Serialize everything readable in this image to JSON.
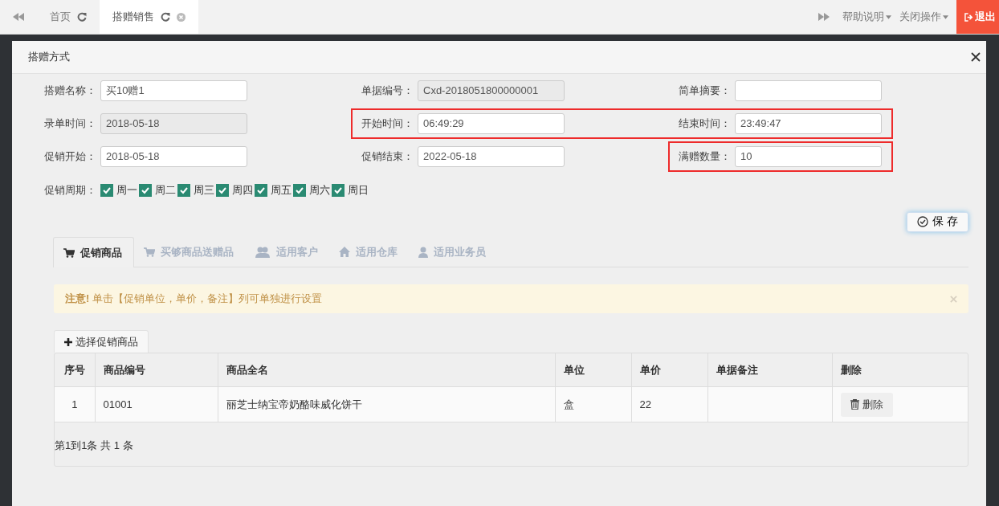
{
  "top_bar": {
    "tabs": [
      {
        "label": "首页",
        "selected": false
      },
      {
        "label": "搭赠销售",
        "selected": true
      }
    ],
    "menus": [
      "帮助说明",
      "关闭操作"
    ],
    "logout_button": "退出"
  },
  "dialog": {
    "title": "搭赠方式",
    "form_rows": [
      [
        {
          "label": "搭赠名称：",
          "value": "买10赠1",
          "disabled": false,
          "highlighted": false
        },
        {
          "label": "单据编号：",
          "value": "Cxd-2018051800000001",
          "disabled": true,
          "highlighted": false
        },
        {
          "label": "简单摘要：",
          "disabled": false,
          "highlighted": false
        }
      ],
      [
        {
          "label": "录单时间：",
          "value": "2018-05-18",
          "disabled": true,
          "highlighted": false
        },
        {
          "label": "开始时间：",
          "value": "06:49:29",
          "disabled": false,
          "highlighted": true
        },
        {
          "label": "结束时间：",
          "value": "23:49:47",
          "disabled": false,
          "highlighted": true
        }
      ],
      [
        {
          "label": "促销开始：",
          "value": "2018-05-18",
          "disabled": false,
          "highlighted": false
        },
        {
          "label": "促销结束：",
          "value": "2022-05-18",
          "disabled": false,
          "highlighted": false
        },
        {
          "label": "满赠数量：",
          "value": "10",
          "disabled": false,
          "highlighted": true
        }
      ]
    ],
    "week": {
      "label": "促销周期：",
      "days": [
        {
          "label": "周一",
          "checked": true
        },
        {
          "label": "周二",
          "checked": true
        },
        {
          "label": "周三",
          "checked": true
        },
        {
          "label": "周四",
          "checked": true
        },
        {
          "label": "周五",
          "checked": true
        },
        {
          "label": "周六",
          "checked": true
        },
        {
          "label": "周日",
          "checked": true
        }
      ]
    },
    "save_button": "保 存",
    "tabs": [
      {
        "label": "促销商品",
        "selected": true
      },
      {
        "label": "买够商品送赠品",
        "selected": false
      },
      {
        "label": "适用客户",
        "selected": false
      },
      {
        "label": "适用仓库",
        "selected": false
      },
      {
        "label": "适用业务员",
        "selected": false
      }
    ],
    "alert": "**注意!** 单击【促销单位，单价，备注】列可单独进行设置",
    "select_button": "选择促销商品",
    "table": {
      "columns": [
        "序号",
        "商品编号",
        "商品全名",
        "单位",
        "单价",
        "单据备注",
        "删除"
      ],
      "rows": [
        {
          "index": "1",
          "code": "01001",
          "name": "丽芝士纳宝帝奶酪味威化饼干",
          "unit": "盒",
          "price": "22",
          "delete_button": "删除"
        }
      ]
    },
    "pagination": "第1到1条 共 1 条"
  }
}
